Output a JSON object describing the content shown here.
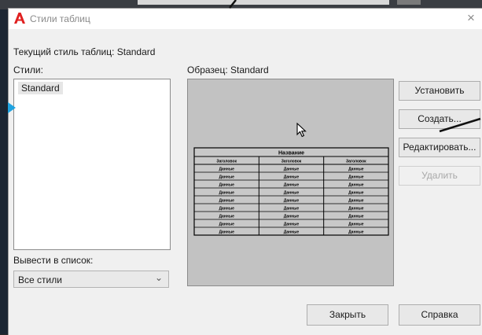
{
  "window": {
    "title": "Стили таблиц",
    "close_glyph": "×"
  },
  "current_style_label": "Текущий стиль таблиц: Standard",
  "styles": {
    "label": "Стили:",
    "items": [
      "Standard"
    ]
  },
  "list_filter": {
    "label": "Вывести в список:",
    "value": "Все стили"
  },
  "preview": {
    "label": "Образец: Standard",
    "table_title": "Название",
    "header_cells": [
      "Заголовок",
      "Заголовок",
      "Заголовок"
    ],
    "data_text": "Данные"
  },
  "buttons": {
    "set_current": "Установить",
    "create": "Создать...",
    "modify": "Редактировать...",
    "delete": "Удалить",
    "close": "Закрыть",
    "help": "Справка"
  },
  "colors": {
    "accent_red": "#e02020",
    "annotation_arrow": "#1fa3e0"
  }
}
